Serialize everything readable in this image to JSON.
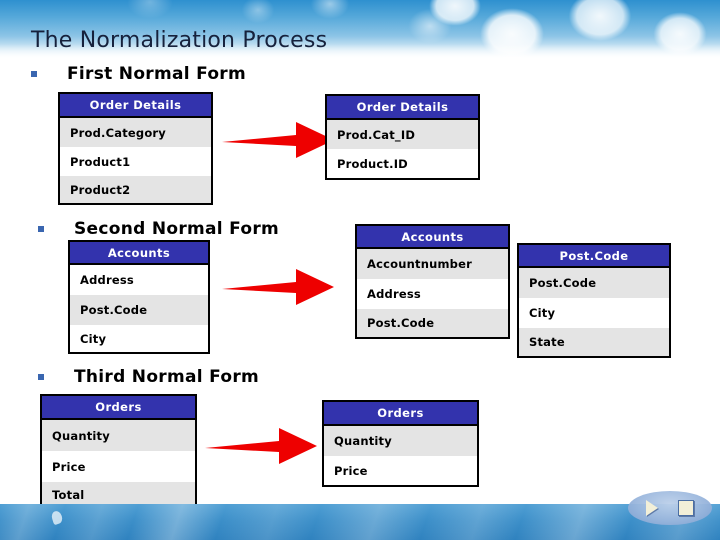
{
  "slide": {
    "title": "The Normalization Process",
    "theme": {
      "header_blue": "#3333ad",
      "arrow_red": "#ee0000",
      "row_alt": "#e4e4e4",
      "row_plain": "#ffffff",
      "bullet_blue": "#3a66b0",
      "background_blue": "#3c8fc9"
    }
  },
  "sections": [
    {
      "id": "first-normal-form",
      "bullet_label": "First Normal  Form",
      "tables": [
        {
          "id": "order-details-before",
          "header": "Order Details",
          "rows": [
            "Prod.Category",
            "Product1",
            "Product2"
          ]
        },
        {
          "id": "order-details-after",
          "header": "Order Details",
          "rows": [
            "Prod.Cat_ID",
            "Product.ID"
          ]
        }
      ],
      "arrow": {
        "name": "transform-arrow-1"
      }
    },
    {
      "id": "second-normal-form",
      "bullet_label": "Second Normal Form",
      "tables": [
        {
          "id": "accounts-before",
          "header": "Accounts",
          "rows": [
            "Address",
            "Post.Code",
            "City"
          ]
        },
        {
          "id": "accounts-after",
          "header": "Accounts",
          "rows": [
            "Accountnumber",
            "Address",
            "Post.Code"
          ]
        },
        {
          "id": "postcode-table",
          "header": "Post.Code",
          "rows": [
            "Post.Code",
            "City",
            "State"
          ]
        }
      ],
      "arrow": {
        "name": "transform-arrow-2"
      }
    },
    {
      "id": "third-normal-form",
      "bullet_label": "Third Normal Form",
      "tables": [
        {
          "id": "orders-before",
          "header": "Orders",
          "rows": [
            "Quantity",
            "Price",
            "Total"
          ]
        },
        {
          "id": "orders-after",
          "header": "Orders",
          "rows": [
            "Quantity",
            "Price"
          ]
        }
      ],
      "arrow": {
        "name": "transform-arrow-3"
      }
    }
  ],
  "nav": {
    "play_label": "play-button",
    "stop_label": "stop-button"
  }
}
